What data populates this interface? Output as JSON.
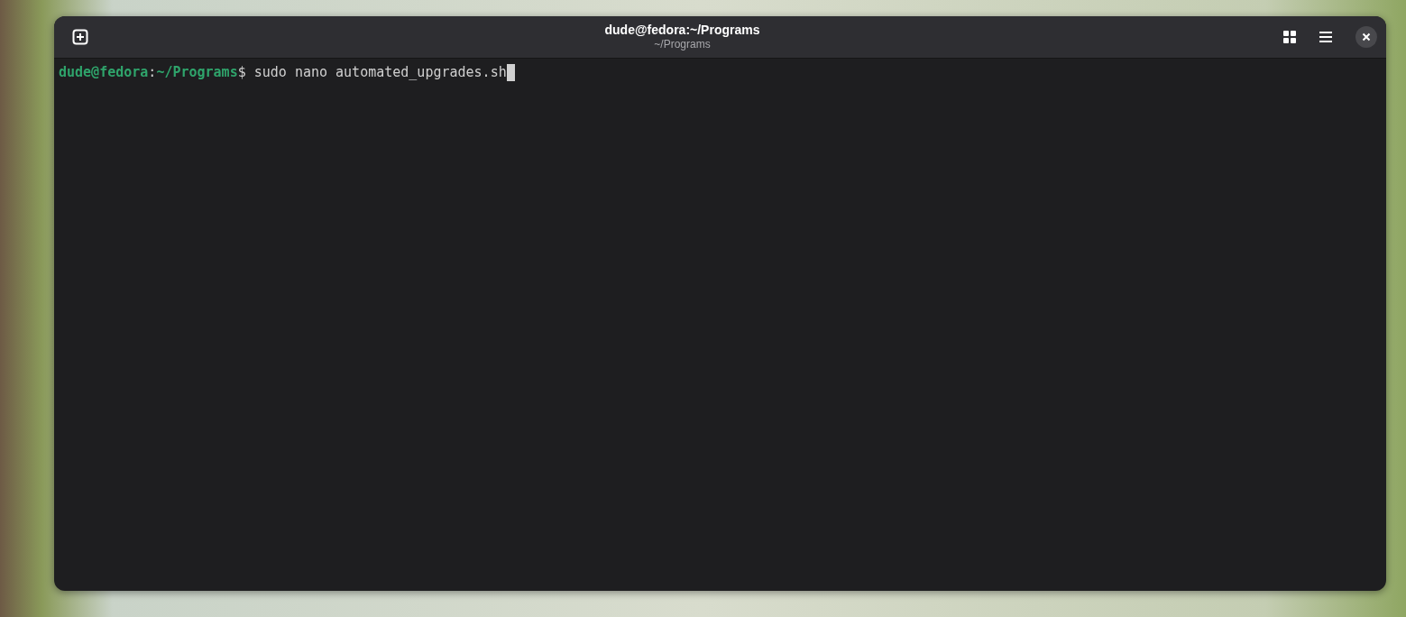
{
  "window": {
    "title": "dude@fedora:~/Programs",
    "subtitle": "~/Programs"
  },
  "terminal": {
    "lines": [
      {
        "segments": [
          {
            "kind": "prompt",
            "text": "dude@fedora"
          },
          {
            "kind": "plain",
            "text": ":"
          },
          {
            "kind": "prompt",
            "text": "~/Programs"
          },
          {
            "kind": "plain",
            "text": "$ sudo nano automated_upgrades.sh"
          }
        ],
        "cursor": true
      }
    ]
  }
}
